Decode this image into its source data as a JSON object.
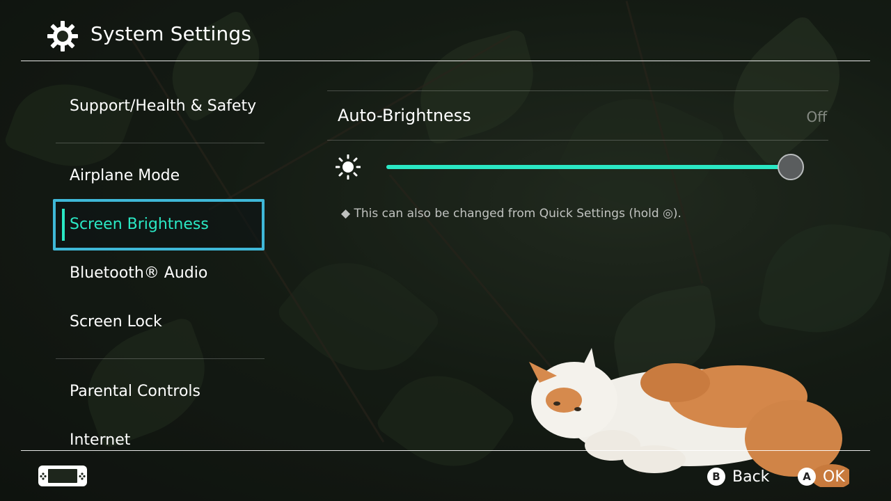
{
  "header": {
    "title": "System Settings",
    "icon": "gear-icon"
  },
  "nav": {
    "items": [
      {
        "label": "Support/Health & Safety"
      },
      {
        "label": "Airplane Mode"
      },
      {
        "label": "Screen Brightness"
      },
      {
        "label": "Bluetooth® Audio"
      },
      {
        "label": "Screen Lock"
      },
      {
        "label": "Parental Controls"
      },
      {
        "label": "Internet"
      }
    ],
    "selected": "Screen Brightness"
  },
  "panel": {
    "auto_brightness": {
      "label": "Auto-Brightness",
      "value": "Off"
    },
    "brightness_slider": {
      "icon": "sun-icon",
      "level": 1.0
    },
    "hint": "◆ This can also be changed from Quick Settings (hold ◎)."
  },
  "footer": {
    "console_icon": "console-icon",
    "back": {
      "button": "B",
      "label": "Back"
    },
    "ok": {
      "button": "A",
      "label": "OK"
    }
  },
  "colors": {
    "accent": "#2ae8c4",
    "focus": "#3fb8d8"
  }
}
